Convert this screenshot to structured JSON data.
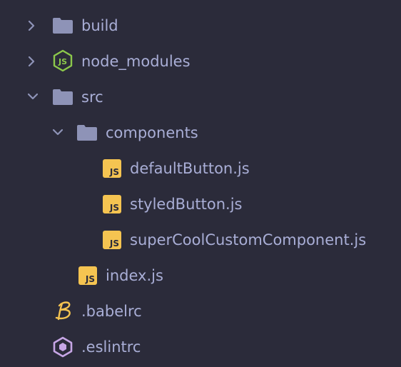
{
  "tree": {
    "items": [
      {
        "label": "build",
        "icon": "folder-icon",
        "expanded": false
      },
      {
        "label": "node_modules",
        "icon": "nodejs-folder-icon",
        "expanded": false
      },
      {
        "label": "src",
        "icon": "folder-icon",
        "expanded": true
      },
      {
        "label": "components",
        "icon": "folder-icon",
        "expanded": true
      },
      {
        "label": "defaultButton.js",
        "icon": "javascript-file-icon"
      },
      {
        "label": "styledButton.js",
        "icon": "javascript-file-icon"
      },
      {
        "label": "superCoolCustomComponent.js",
        "icon": "javascript-file-icon"
      },
      {
        "label": "index.js",
        "icon": "javascript-file-icon"
      },
      {
        "label": ".babelrc",
        "icon": "babel-icon"
      },
      {
        "label": ".eslintrc",
        "icon": "eslint-icon"
      }
    ],
    "js_badge_text": "JS",
    "node_badge_text": "JS"
  },
  "colors": {
    "background": "#2b2b3a",
    "text": "#a9aed6",
    "folder": "#8e93b7",
    "js_badge": "#f5c451",
    "nodejs": "#8cc84b",
    "babel": "#f5c451",
    "eslint": "#c7a6e6"
  }
}
